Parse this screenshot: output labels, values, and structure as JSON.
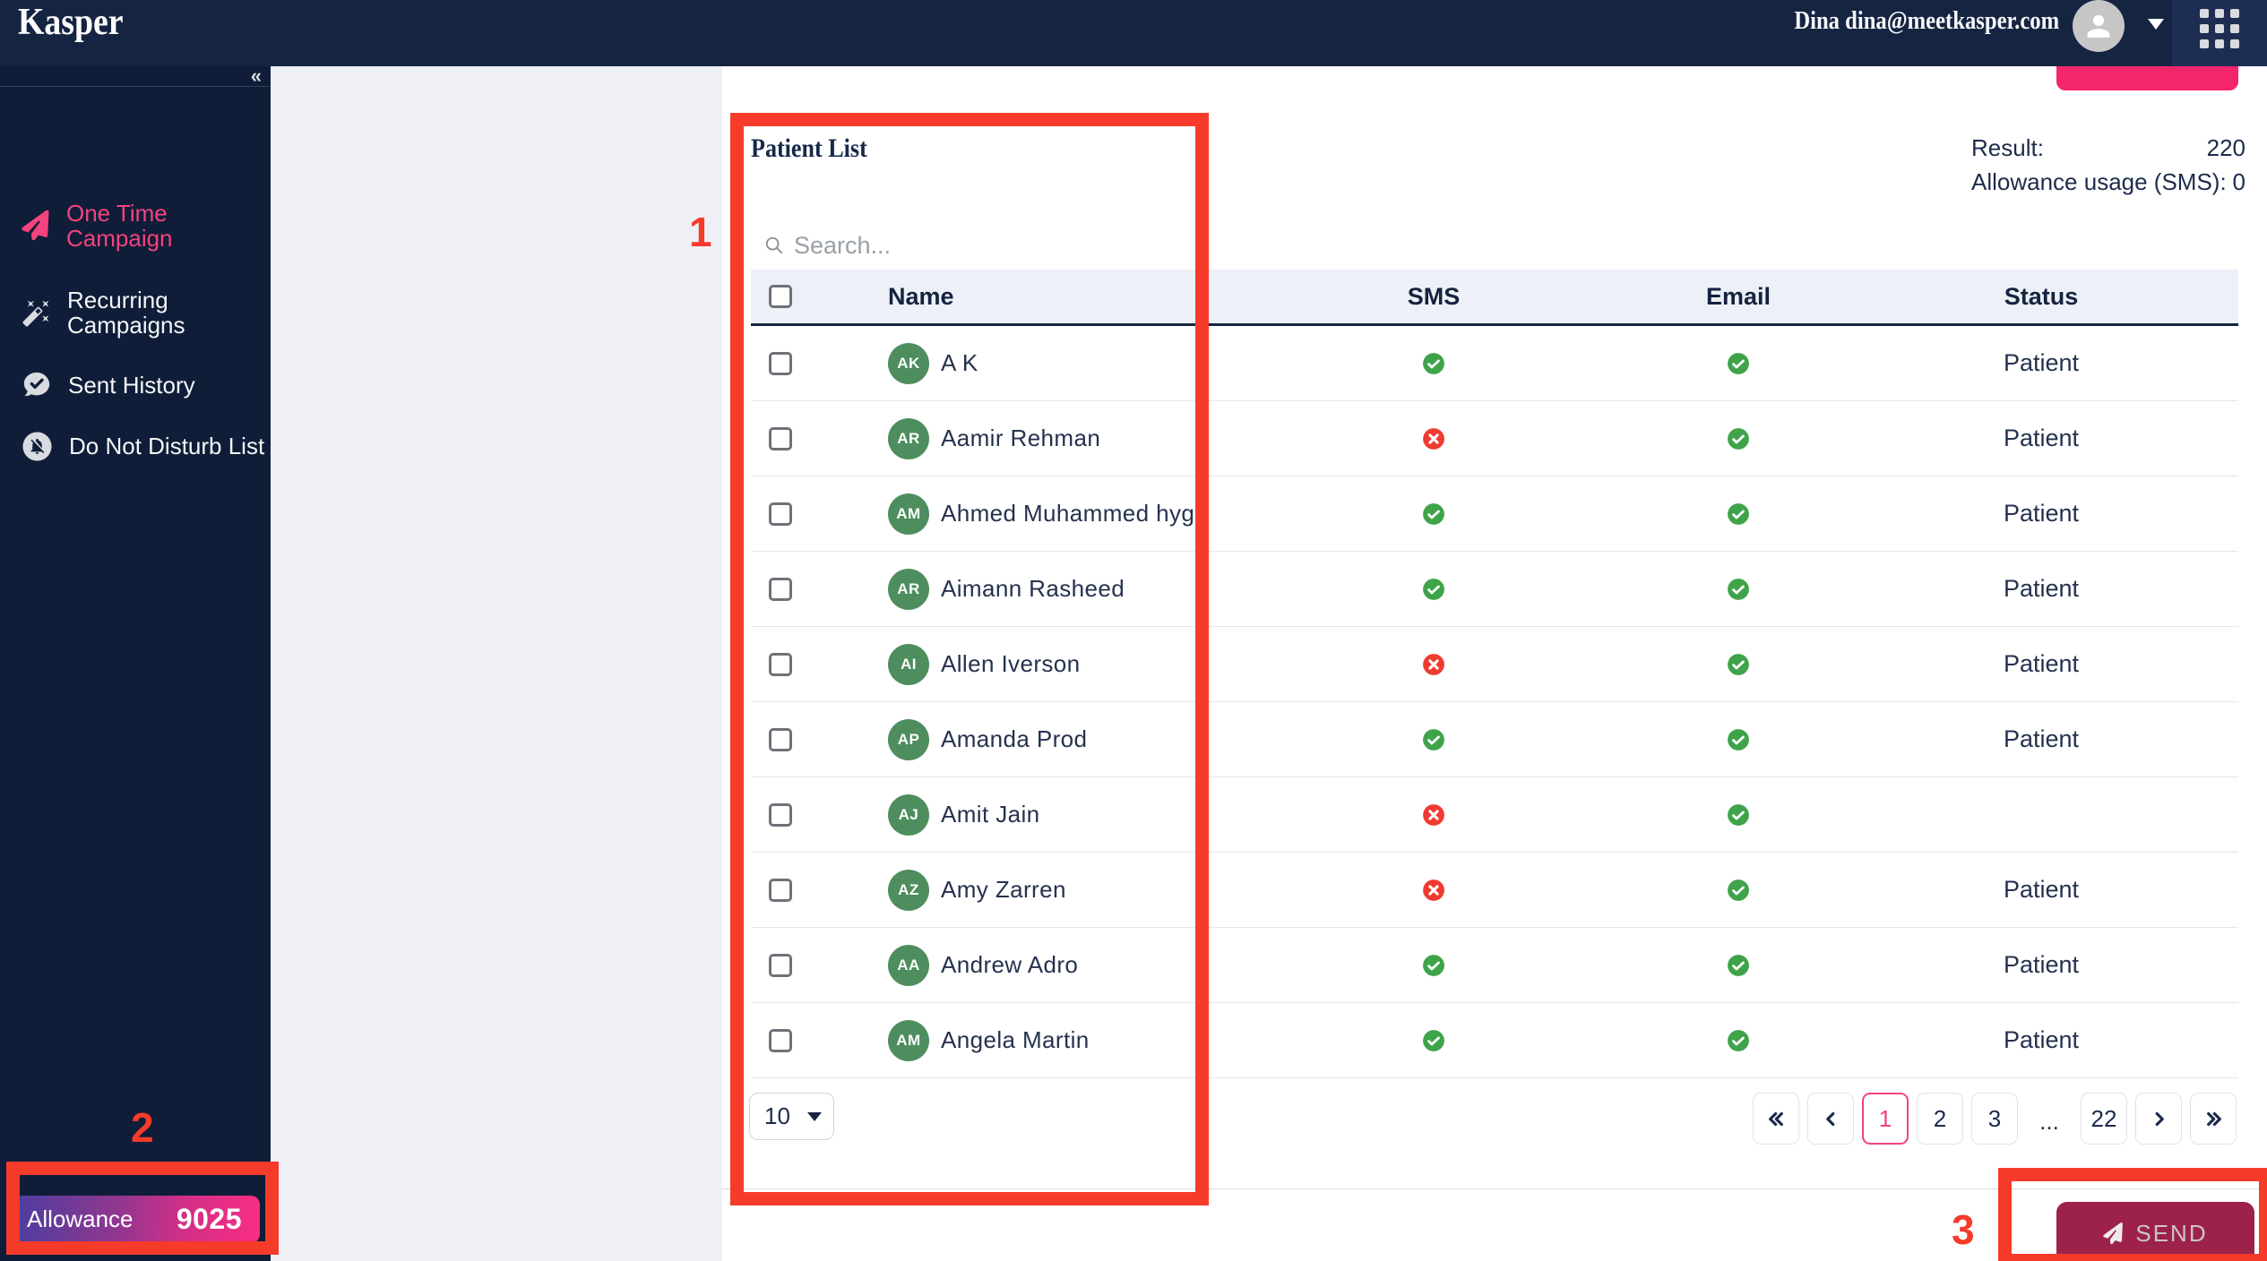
{
  "app": {
    "logo_text": "Kasper",
    "user_display": "Dina dina@meetkasper.com"
  },
  "sidebar": {
    "collapse_glyph": "«",
    "items": [
      {
        "label": "One Time Campaign",
        "icon": "paper-plane-icon",
        "active": true
      },
      {
        "label": "Recurring Campaigns",
        "icon": "magic-wand-icon",
        "active": false
      },
      {
        "label": "Sent History",
        "icon": "chat-check-icon",
        "active": false
      },
      {
        "label": "Do Not Disturb List",
        "icon": "bell-slash-icon",
        "active": false
      }
    ],
    "allowance": {
      "label": "Allowance",
      "value": "9025"
    }
  },
  "main": {
    "title": "Patient List",
    "search_placeholder": "Search...",
    "summary": {
      "result_label": "Result:",
      "result_value": "220",
      "usage_label": "Allowance usage (SMS):",
      "usage_value": "0"
    },
    "table": {
      "columns": {
        "name": "Name",
        "sms": "SMS",
        "email": "Email",
        "status": "Status"
      },
      "rows": [
        {
          "initials": "AK",
          "name": "A K",
          "sms": true,
          "email": true,
          "status": "Patient"
        },
        {
          "initials": "AR",
          "name": "Aamir Rehman",
          "sms": false,
          "email": true,
          "status": "Patient"
        },
        {
          "initials": "AM",
          "name": "Ahmed Muhammed hyg",
          "sms": true,
          "email": true,
          "status": "Patient"
        },
        {
          "initials": "AR",
          "name": "Aimann Rasheed",
          "sms": true,
          "email": true,
          "status": "Patient"
        },
        {
          "initials": "AI",
          "name": "Allen Iverson",
          "sms": false,
          "email": true,
          "status": "Patient"
        },
        {
          "initials": "AP",
          "name": "Amanda Prod",
          "sms": true,
          "email": true,
          "status": "Patient"
        },
        {
          "initials": "AJ",
          "name": "Amit Jain",
          "sms": false,
          "email": true,
          "status": ""
        },
        {
          "initials": "AZ",
          "name": "Amy Zarren",
          "sms": false,
          "email": true,
          "status": "Patient"
        },
        {
          "initials": "AA",
          "name": "Andrew Adro",
          "sms": true,
          "email": true,
          "status": "Patient"
        },
        {
          "initials": "AM",
          "name": "Angela Martin",
          "sms": true,
          "email": true,
          "status": "Patient"
        }
      ]
    },
    "pagination": {
      "rows_per_page": "10",
      "buttons": [
        {
          "label": "«",
          "type": "first"
        },
        {
          "label": "‹",
          "type": "prev"
        },
        {
          "label": "1",
          "type": "page",
          "active": true
        },
        {
          "label": "2",
          "type": "page",
          "active": false
        },
        {
          "label": "3",
          "type": "page",
          "active": false
        },
        {
          "label": "...",
          "type": "ellipsis"
        },
        {
          "label": "22",
          "type": "page",
          "active": false
        },
        {
          "label": "›",
          "type": "next"
        },
        {
          "label": "»",
          "type": "last"
        }
      ]
    },
    "send_label": "SEND"
  },
  "annotations": {
    "labels": [
      "1",
      "2",
      "3"
    ],
    "color": "#f63b2a"
  },
  "colors": {
    "top_bar": "#152441",
    "sidebar": "#0f1d38",
    "accent_pink": "#f4437d",
    "primary_button_pink": "#f5256c",
    "send_button_maroon": "#9c224b",
    "allowed_green": "#3fa34a",
    "blocked_red": "#ef3b31",
    "avatar_green": "#4e8d5e",
    "annotation_red": "#f63b2a"
  }
}
